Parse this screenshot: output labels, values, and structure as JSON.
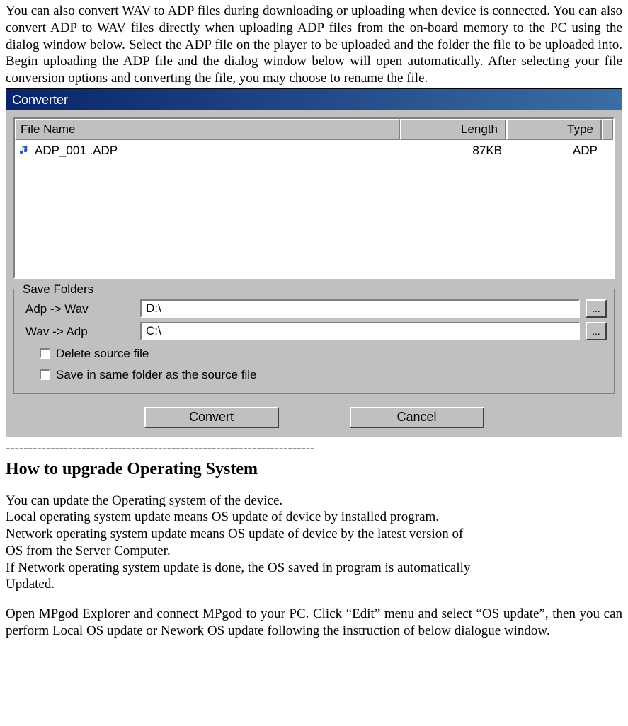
{
  "intro_paragraph": "You can also convert WAV to ADP files during downloading or uploading when device is connected. You can also convert ADP to WAV files directly when uploading ADP files from the on-board memory to the PC using the dialog window below. Select the ADP file on the player to be uploaded and the folder the file to be uploaded into. Begin uploading the ADP file and the dialog window below will open automatically. After selecting your file conversion options and converting the file, you may choose to rename the file.",
  "dialog": {
    "title": "Converter",
    "columns": {
      "filename": "File Name",
      "length": "Length",
      "type": "Type"
    },
    "rows": [
      {
        "filename": "ADP_001 .ADP",
        "length": "87KB",
        "type": "ADP"
      }
    ],
    "save_folders": {
      "legend": "Save Folders",
      "adp_wav_label": "Adp -> Wav",
      "adp_wav_path": "D:\\",
      "wav_adp_label": "Wav -> Adp",
      "wav_adp_path": "C:\\",
      "browse_label": "...",
      "delete_source_label": "Delete source file",
      "same_folder_label": "Save in same folder as the source file"
    },
    "buttons": {
      "convert": "Convert",
      "cancel": "Cancel"
    }
  },
  "separator": "---------------------------------------------------------------------",
  "heading": "How to upgrade Operating System",
  "body_lines": [
    "You can update the Operating system of the device.",
    "Local operating system update means OS update of device by installed program.",
    "Network operating system update means OS update of device by the latest version of",
    "OS from the Server Computer.",
    "If Network operating system update is done, the OS saved in program is automatically",
    "Updated."
  ],
  "final_paragraph": "Open MPgod Explorer and connect MPgod to your PC. Click “Edit” menu and select “OS update”, then you can perform Local OS update or Nework OS update following the instruction of below dialogue window."
}
